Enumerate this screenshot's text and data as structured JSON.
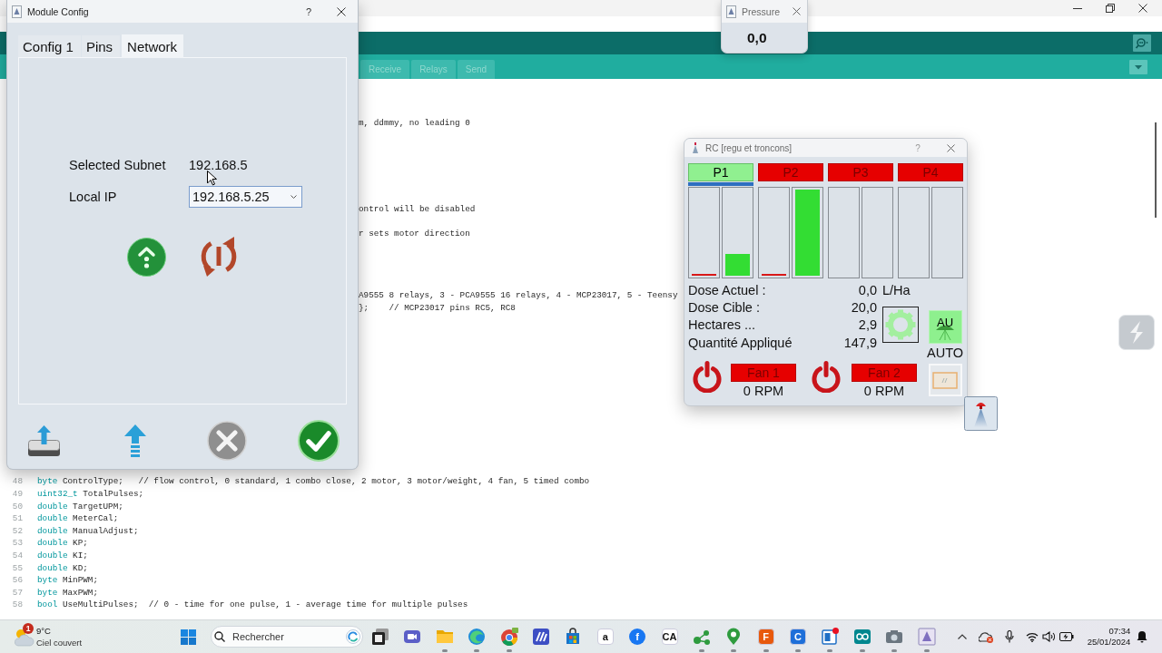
{
  "ide": {
    "tabs": [
      {
        "label": "Receive",
        "selected": false
      },
      {
        "label": "Relays",
        "selected": false
      },
      {
        "label": "Send",
        "selected": false
      }
    ],
    "code_fragments": [
      "m, ddmmy, no leading 0",
      "ontrol will be disabled",
      "r sets motor direction",
      "A9555 8 relays, 3 - PCA9555 16 relays, 4 - MCP23017, 5 - Teensy",
      "};    // MCP23017 pins RC5, RC8"
    ],
    "code_lines": [
      {
        "number": "48",
        "keyword": "byte",
        "code": "ControlType;   // flow control, 0 standard, 1 combo close, 2 motor, 3 motor/weight, 4 fan, 5 timed combo"
      },
      {
        "number": "49",
        "keyword": "uint32_t",
        "code": "TotalPulses;"
      },
      {
        "number": "50",
        "keyword": "double",
        "code": "TargetUPM;"
      },
      {
        "number": "51",
        "keyword": "double",
        "code": "MeterCal;"
      },
      {
        "number": "52",
        "keyword": "double",
        "code": "ManualAdjust;"
      },
      {
        "number": "53",
        "keyword": "double",
        "code": "KP;"
      },
      {
        "number": "54",
        "keyword": "double",
        "code": "KI;"
      },
      {
        "number": "55",
        "keyword": "double",
        "code": "KD;"
      },
      {
        "number": "56",
        "keyword": "byte",
        "code": "MinPWM;"
      },
      {
        "number": "57",
        "keyword": "byte",
        "code": "MaxPWM;"
      },
      {
        "number": "58",
        "keyword": "bool",
        "code": "UseMultiPulses;  // 0 - time for one pulse, 1 - average time for multiple pulses"
      }
    ]
  },
  "module_config": {
    "title": "Module Config",
    "help": "?",
    "tabs": [
      {
        "label": "Config 1",
        "selected": false
      },
      {
        "label": "Pins",
        "selected": false
      },
      {
        "label": "Network",
        "selected": true
      }
    ],
    "fields": [
      {
        "label": "Selected Subnet",
        "kind": "text",
        "value": "192.168.5"
      },
      {
        "label": "Local IP",
        "kind": "dropdown",
        "value": "192.168.5.25"
      }
    ]
  },
  "pressure": {
    "title": "Pressure",
    "value": "0,0"
  },
  "rc": {
    "title": "RC [regu et troncons]",
    "help": "?",
    "products": [
      {
        "label": "P1",
        "on": true,
        "selected": true,
        "bars": [
          {
            "level": 0.02,
            "color": "#d81818"
          },
          {
            "level": 0.25,
            "color": "#33dd33"
          }
        ]
      },
      {
        "label": "P2",
        "on": false,
        "selected": false,
        "bars": [
          {
            "level": 0.02,
            "color": "#d81818"
          },
          {
            "level": 1,
            "color": "#33dd33"
          }
        ]
      },
      {
        "label": "P3",
        "on": false,
        "selected": false,
        "bars": [
          {
            "level": 0
          },
          {
            "level": 0
          }
        ]
      },
      {
        "label": "P4",
        "on": false,
        "selected": false,
        "bars": [
          {
            "level": 0
          },
          {
            "level": 0
          }
        ]
      }
    ],
    "readings": [
      {
        "label": "Dose Actuel :",
        "value": "0,0",
        "unit": "L/Ha"
      },
      {
        "label": "Dose Cible :",
        "value": "20,0"
      },
      {
        "label": "Hectares ...",
        "value": "2,9"
      },
      {
        "label": "Quantité Appliqué",
        "value": "147,9"
      }
    ],
    "auto_button": "AU",
    "mode": "AUTO",
    "fans": [
      {
        "label": "Fan 1",
        "on": false,
        "reading": "0 RPM"
      },
      {
        "label": "Fan 2",
        "on": false,
        "reading": "0 RPM"
      }
    ]
  },
  "taskbar": {
    "weather": {
      "badge": "1",
      "temperature": "9°C",
      "condition": "Ciel couvert"
    },
    "search": {
      "placeholder": "Rechercher"
    },
    "apps": [
      {
        "kind": "square",
        "running": false
      },
      {
        "kind": "video",
        "running": false
      },
      {
        "kind": "folder",
        "running": true
      },
      {
        "kind": "swirl",
        "running": true
      },
      {
        "kind": "wheel",
        "running": true
      },
      {
        "kind": "stripes",
        "running": false
      },
      {
        "kind": "bag",
        "running": false
      },
      {
        "kind": "tile",
        "glyph": "a",
        "color": "#ffffff",
        "running": false
      },
      {
        "kind": "disc",
        "glyph": "f",
        "color": "#1877f2",
        "running": false
      },
      {
        "kind": "tile",
        "glyph": "CA",
        "color": "#ffffff",
        "running": false
      },
      {
        "kind": "nodes",
        "running": true
      },
      {
        "kind": "pin",
        "running": true
      },
      {
        "kind": "tile",
        "glyph": "F",
        "color": "#e8590c",
        "running": true
      },
      {
        "kind": "tile",
        "glyph": "C",
        "color": "#1e6fd9",
        "running": true
      },
      {
        "kind": "note",
        "running": true
      },
      {
        "kind": "infinity",
        "running": true
      },
      {
        "kind": "camera",
        "running": true
      },
      {
        "kind": "triangle",
        "running": true
      }
    ],
    "clock": {
      "time": "07:34",
      "date": "25/01/2024"
    }
  }
}
